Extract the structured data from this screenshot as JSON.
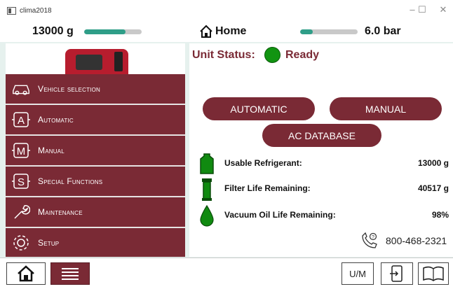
{
  "window": {
    "title": "clima2018",
    "minimize_glyph": "–",
    "maximize_glyph": "☐",
    "close_glyph": "✕"
  },
  "header": {
    "tank_weight": "13000 g",
    "tank_level": 0.72,
    "home_label": "Home",
    "pressure": "6.0 bar",
    "pressure_level": 0.22,
    "accent_color": "#2f9e88"
  },
  "sidebar": {
    "items": [
      {
        "label": "Vehicle selection",
        "icon": "car-icon"
      },
      {
        "label": "Automatic",
        "icon": "automatic-icon"
      },
      {
        "label": "Manual",
        "icon": "manual-icon"
      },
      {
        "label": "Special Functions",
        "icon": "special-functions-icon"
      },
      {
        "label": "Maintenance",
        "icon": "wrench-icon"
      },
      {
        "label": "Setup",
        "icon": "gear-icon"
      }
    ],
    "color": "#7a2a35"
  },
  "status": {
    "label": "Unit Status:",
    "value": "Ready",
    "indicator_color": "#119411"
  },
  "buttons": {
    "automatic": "AUTOMATIC",
    "manual": "MANUAL",
    "ac_database": "AC DATABASE"
  },
  "info": [
    {
      "label": "Usable Refrigerant:",
      "value": "13000 g",
      "icon": "refrigerant-tank-icon"
    },
    {
      "label": "Filter Life Remaining:",
      "value": "40517 g",
      "icon": "filter-icon"
    },
    {
      "label": "Vacuum Oil Life Remaining:",
      "value": "98%",
      "icon": "oil-drop-icon"
    }
  ],
  "support": {
    "phone": "800-468-2321",
    "icon": "phone-icon"
  },
  "bottombar": {
    "um_label": "U/M",
    "icons": [
      "home-icon",
      "menu-icon",
      "exit-icon",
      "manual-book-icon"
    ]
  }
}
